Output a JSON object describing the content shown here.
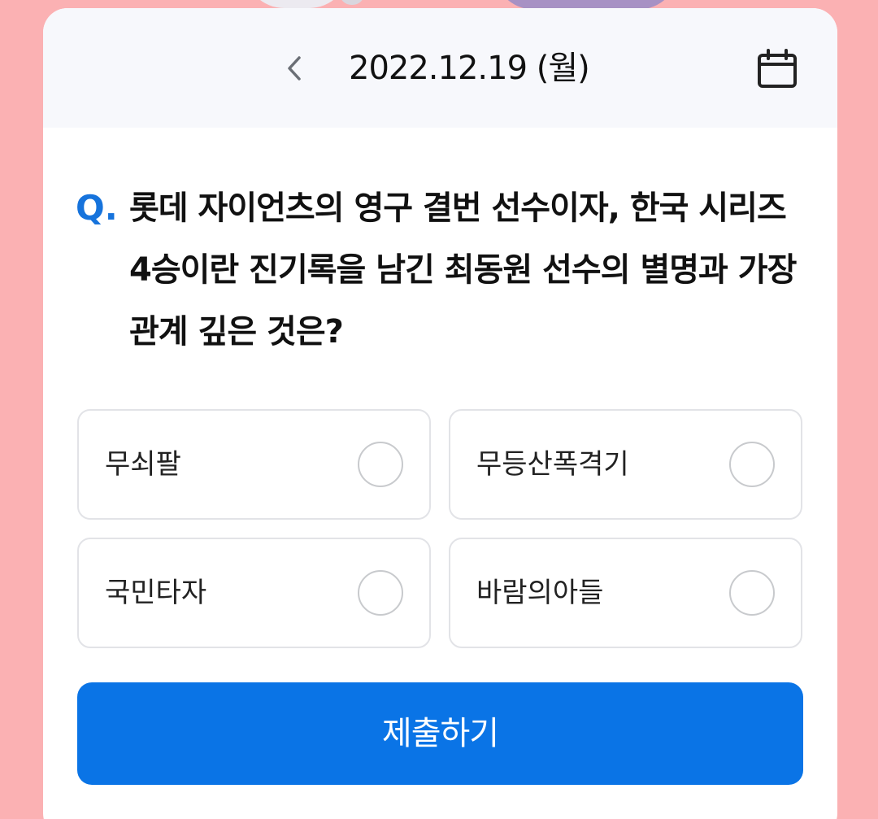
{
  "header": {
    "date": "2022.12.19 (월)",
    "back_icon": "chevron-left-icon",
    "calendar_icon": "calendar-icon"
  },
  "question": {
    "marker": "Q.",
    "text": "롯데 자이언츠의 영구 결번 선수이자, 한국 시리즈 4승이란 진기록을 남긴 최동원 선수의 별명과 가장 관계 깊은 것은?"
  },
  "options": [
    {
      "label": "무쇠팔"
    },
    {
      "label": "무등산폭격기"
    },
    {
      "label": "국민타자"
    },
    {
      "label": "바람의아들"
    }
  ],
  "submit": {
    "label": "제출하기"
  },
  "colors": {
    "background": "#fbb1b3",
    "accent": "#0a74e6",
    "question_marker": "#1673dc",
    "header_bg": "#f7f8fc"
  }
}
